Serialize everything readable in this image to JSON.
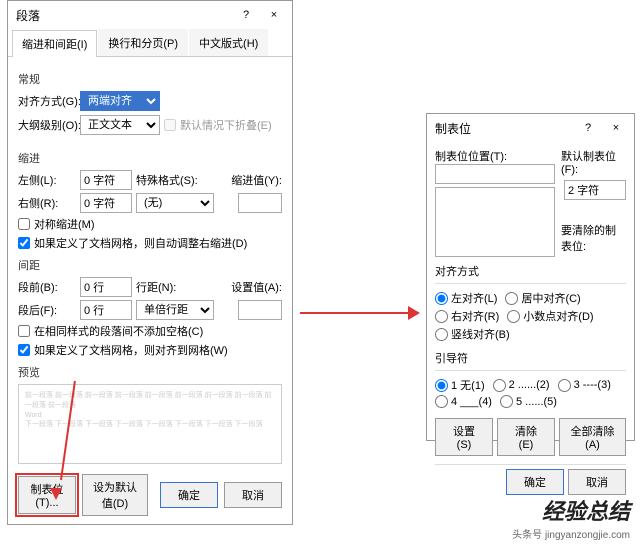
{
  "dlg1": {
    "title": "段落",
    "tabs": [
      "缩进和间距(I)",
      "换行和分页(P)",
      "中文版式(H)"
    ],
    "general": {
      "title": "常规",
      "align_label": "对齐方式(G):",
      "align_value": "两端对齐",
      "outline_label": "大纲级别(O):",
      "outline_value": "正文文本",
      "collapse": "默认情况下折叠(E)"
    },
    "indent": {
      "title": "缩进",
      "left_label": "左侧(L):",
      "left_value": "0 字符",
      "right_label": "右侧(R):",
      "right_value": "0 字符",
      "special_label": "特殊格式(S):",
      "special_value": "(无)",
      "indent_val_label": "缩进值(Y):",
      "mirror": "对称缩进(M)",
      "autogrid": "如果定义了文档网格，则自动调整右缩进(D)"
    },
    "spacing": {
      "title": "间距",
      "before_label": "段前(B):",
      "before_value": "0 行",
      "after_label": "段后(F):",
      "after_value": "0 行",
      "linespace_label": "行距(N):",
      "linespace_value": "单倍行距",
      "setval_label": "设置值(A):",
      "nospace": "在相同样式的段落间不添加空格(C)",
      "snapgrid": "如果定义了文档网格，则对齐到网格(W)"
    },
    "preview_title": "预览",
    "footer": {
      "tabstop": "制表位(T)...",
      "default": "设为默认值(D)",
      "ok": "确定",
      "cancel": "取消"
    }
  },
  "dlg2": {
    "title": "制表位",
    "pos_label": "制表位位置(T):",
    "default_label": "默认制表位(F):",
    "default_value": "2 字符",
    "clear_label": "要清除的制表位:",
    "align": {
      "title": "对齐方式",
      "opts": [
        "左对齐(L)",
        "居中对齐(C)",
        "右对齐(R)",
        "小数点对齐(D)",
        "竖线对齐(B)"
      ]
    },
    "leader": {
      "title": "引导符",
      "opts": [
        "1 无(1)",
        "2 ......(2)",
        "3 ----(3)",
        "4 ___(4)",
        "5 ......(5)"
      ]
    },
    "set": "设置(S)",
    "clear": "清除(E)",
    "clearall": "全部清除(A)",
    "ok": "确定",
    "cancel": "取消"
  },
  "watermark": {
    "big": "经验总结",
    "small": "头条号 jingyanzongjie.com"
  }
}
